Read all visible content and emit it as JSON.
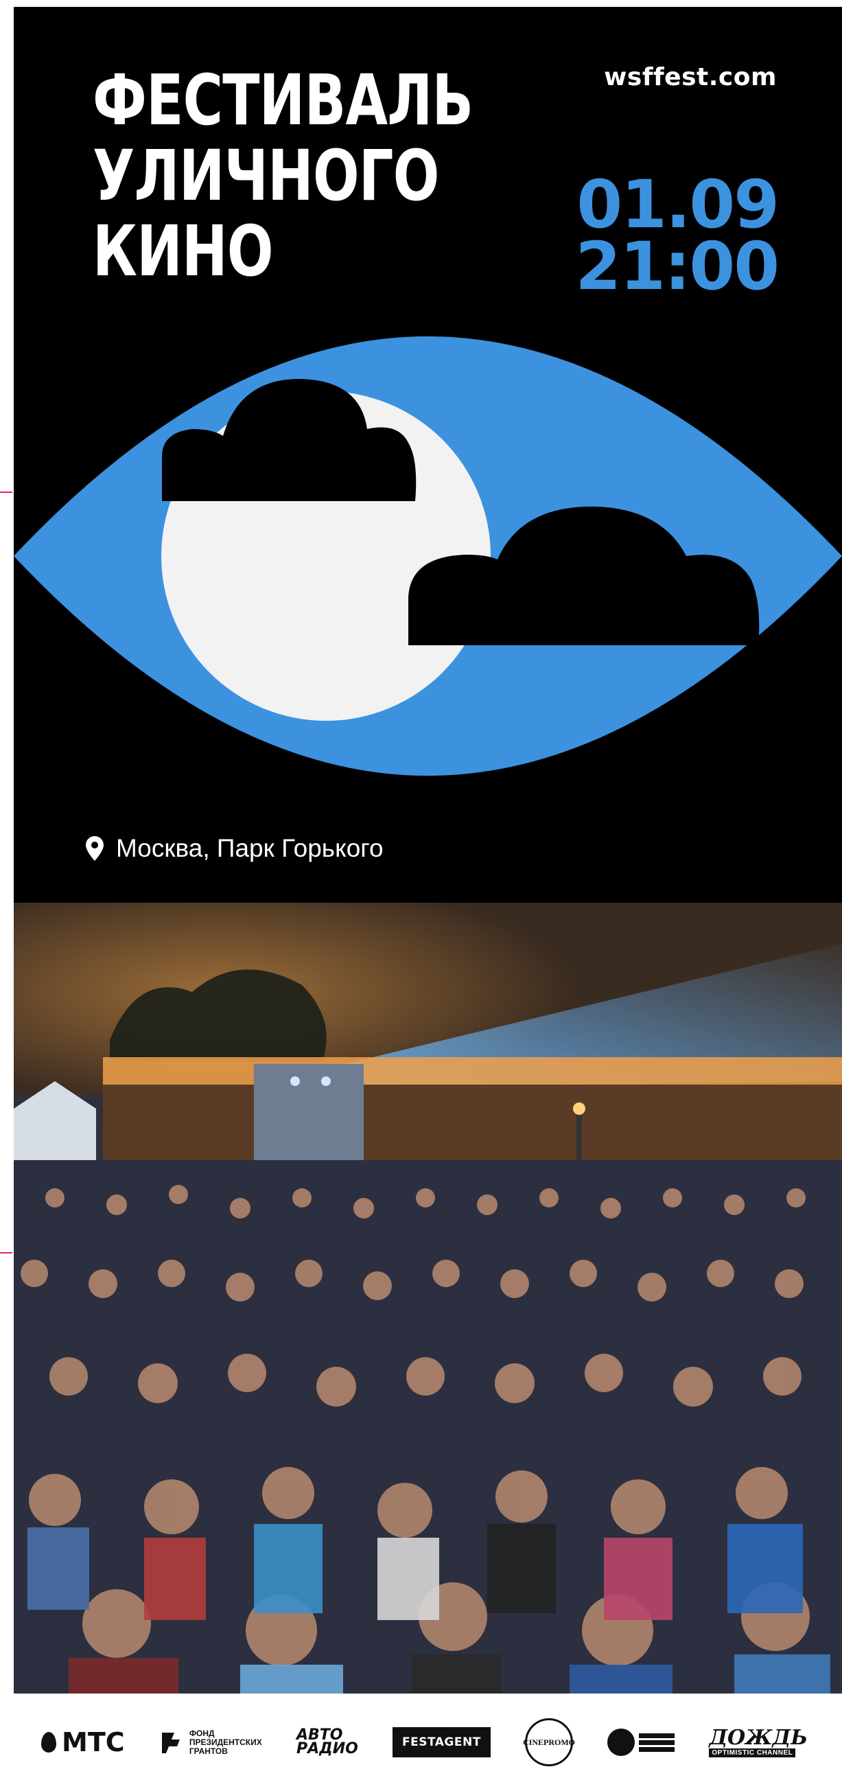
{
  "poster": {
    "title_lines": [
      "ФЕСТИВАЛЬ",
      "УЛИЧНОГО",
      "КИНО"
    ],
    "website": "wsffest.com",
    "date": "01.09",
    "time": "21:00",
    "location": "Москва, Парк Горького",
    "location_icon": "map-pin-icon",
    "colors": {
      "background": "#000000",
      "accent_blue": "#3d92e0",
      "moon": "#f2f2f2",
      "text": "#ffffff",
      "trim_marks": "#e0207a"
    }
  },
  "photo": {
    "subject": "crowd-photo"
  },
  "sponsors": {
    "mts": "МТС",
    "fund": [
      "ФОНД",
      "ПРЕЗИДЕНТСКИХ",
      "ГРАНТОВ"
    ],
    "avtoradio": [
      "АВТО",
      "РАДИО"
    ],
    "festagent": "FESTAGENT",
    "cinepromo": "CINEPROMO",
    "dozhd": "ДОЖДЬ",
    "dozhd_sub": "OPTIMISTIC CHANNEL"
  }
}
